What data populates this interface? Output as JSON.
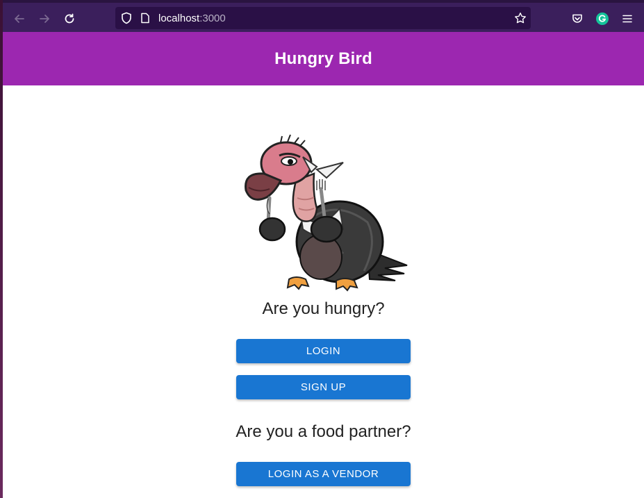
{
  "browser": {
    "url_host": "localhost",
    "url_port": ":3000"
  },
  "app": {
    "title": "Hungry Bird"
  },
  "main": {
    "customer_heading": "Are you hungry?",
    "login_label": "LOGIN",
    "signup_label": "SIGN UP",
    "partner_heading": "Are you a food partner?",
    "vendor_login_label": "LOGIN AS A VENDOR"
  },
  "icons": {
    "back": "back-arrow-icon",
    "forward": "forward-arrow-icon",
    "reload": "reload-icon",
    "shield": "shield-icon",
    "page": "page-icon",
    "bookmark": "star-icon",
    "pocket": "pocket-icon",
    "grammarly": "grammarly-icon",
    "menu": "hamburger-menu-icon"
  },
  "colors": {
    "appbar": "#9c27b0",
    "button": "#1976d2",
    "browser_toolbar": "#3b1f5c"
  }
}
